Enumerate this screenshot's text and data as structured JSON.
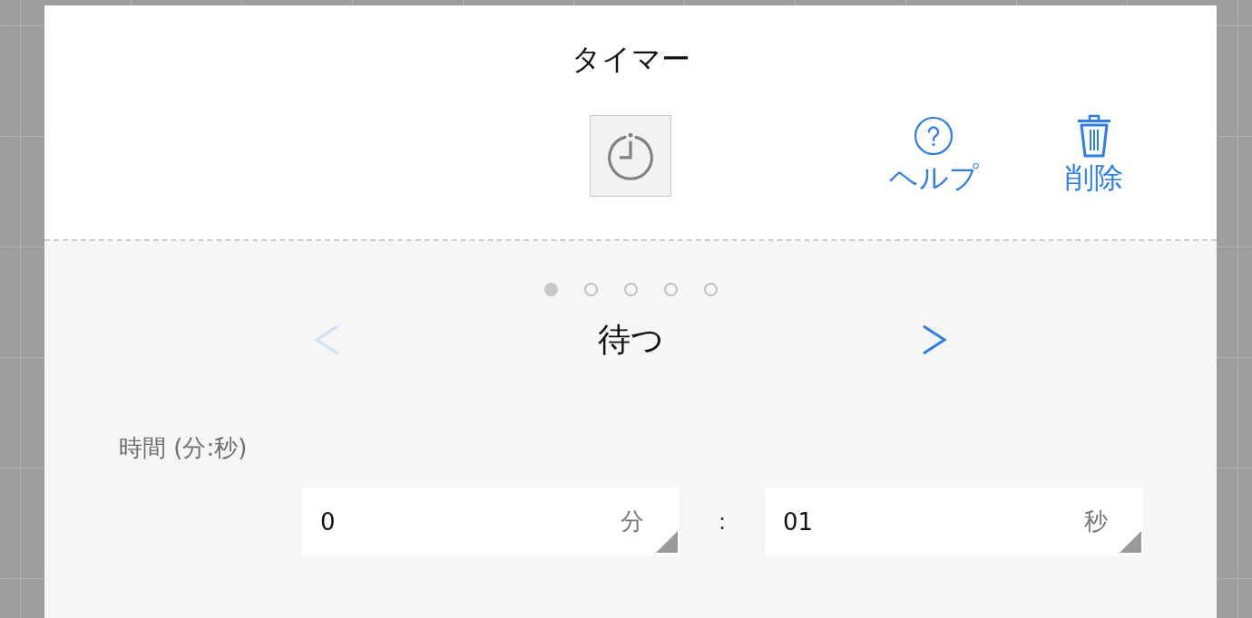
{
  "dialog": {
    "title": "タイマー"
  },
  "actions": [
    {
      "kind": "help",
      "label": "ヘルプ"
    },
    {
      "kind": "delete",
      "label": "削除"
    }
  ],
  "pager": {
    "dots": [
      {
        "selected": true
      },
      {
        "selected": false
      },
      {
        "selected": false
      },
      {
        "selected": false
      },
      {
        "selected": false
      }
    ]
  },
  "step": {
    "title": "待つ",
    "prev": {
      "disabled": true
    },
    "next": {
      "disabled": false
    }
  },
  "duration": {
    "label": "時間 (分:秒)",
    "fields": [
      {
        "value": "0",
        "unit": "分"
      },
      {
        "value": "01",
        "unit": "秒"
      }
    ],
    "separator": ":"
  }
}
